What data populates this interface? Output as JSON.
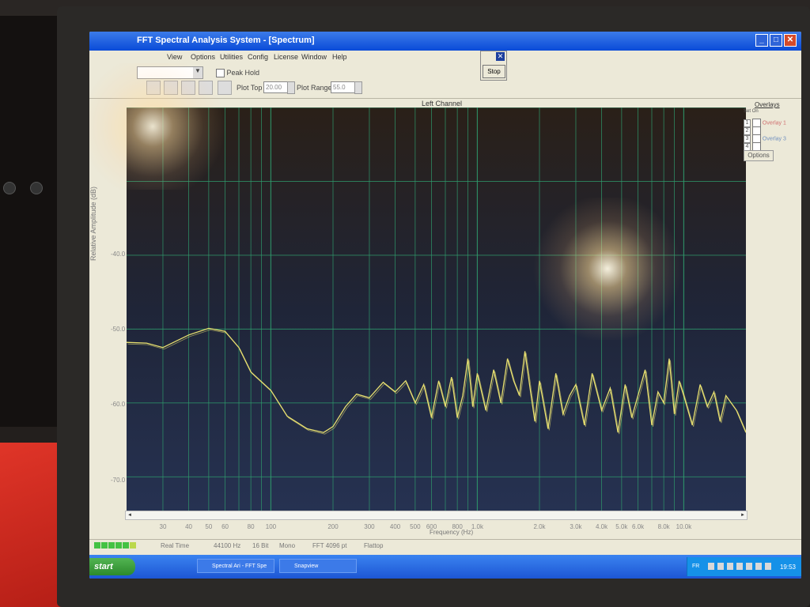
{
  "window": {
    "title": "FFT Spectral Analysis System - [Spectrum]",
    "icon": "app-icon"
  },
  "menu": [
    "View",
    "Options",
    "Utilities",
    "Config",
    "License",
    "Window",
    "Help"
  ],
  "toolbar": {
    "peak_hold_label": "Peak Hold",
    "plot_top_label": "Plot Top",
    "plot_top_value": "20.00",
    "plot_range_label": "Plot Range",
    "plot_range_value": "55.0"
  },
  "stop_dialog": {
    "button_label": "Stop",
    "close_glyph": "✕"
  },
  "channel_title": "Left Channel",
  "overlays": {
    "header": "Overlays",
    "set_label": "Set",
    "on_label": "On",
    "rows": [
      {
        "num": "1",
        "label": "Overlay 1",
        "color": "#d07070"
      },
      {
        "num": "2",
        "label": "",
        "color": "#d07070"
      },
      {
        "num": "3",
        "label": "Overlay 3",
        "color": "#7090c0"
      },
      {
        "num": "4",
        "label": "",
        "color": "#7090c0"
      }
    ],
    "options_label": "Options"
  },
  "chart_data": {
    "type": "line",
    "title": "Left Channel",
    "xlabel": "Frequency (Hz)",
    "ylabel": "Relative Amplitude (dB)",
    "x_scale": "log",
    "xlim": [
      20,
      20000
    ],
    "ylim": [
      -75,
      -20
    ],
    "y_ticks": [
      "-40.0",
      "-50.0",
      "-60.0",
      "-70.0"
    ],
    "x_ticks": [
      "30",
      "40",
      "50",
      "60",
      "80",
      "100",
      "200",
      "300",
      "400",
      "500",
      "600",
      "800",
      "1.0k",
      "2.0k",
      "3.0k",
      "4.0k",
      "5.0k",
      "6.0k",
      "8.0k",
      "10.0k"
    ],
    "grid": true,
    "series": [
      {
        "color": "#e8e070",
        "x": [
          20,
          25,
          30,
          40,
          50,
          60,
          70,
          80,
          100,
          120,
          150,
          180,
          200,
          230,
          260,
          300,
          350,
          400,
          450,
          500,
          550,
          600,
          650,
          700,
          750,
          800,
          850,
          900,
          950,
          1000,
          1100,
          1200,
          1300,
          1400,
          1500,
          1600,
          1700,
          1800,
          1900,
          2000,
          2200,
          2400,
          2600,
          2800,
          3000,
          3300,
          3600,
          4000,
          4400,
          4800,
          5200,
          5600,
          6000,
          6500,
          7000,
          7500,
          8000,
          8500,
          9000,
          9500,
          10000,
          11000,
          12000,
          13000,
          14000,
          15000,
          16000,
          18000,
          20000
        ],
        "y": [
          -51.8,
          -51.9,
          -52.5,
          -50.8,
          -49.9,
          -50.3,
          -52.5,
          -55.8,
          -58.3,
          -61.8,
          -63.5,
          -64.0,
          -63.2,
          -60.5,
          -58.8,
          -59.3,
          -57.2,
          -58.5,
          -57.0,
          -60.0,
          -57.5,
          -62.0,
          -57.0,
          -60.5,
          -56.5,
          -62.0,
          -59.0,
          -54.0,
          -60.5,
          -56.0,
          -61.0,
          -55.5,
          -60.0,
          -54.0,
          -57.0,
          -59.0,
          -53.0,
          -58.0,
          -62.5,
          -57.0,
          -63.5,
          -56.0,
          -61.5,
          -59.0,
          -57.5,
          -63.0,
          -56.0,
          -61.0,
          -58.0,
          -64.0,
          -57.5,
          -62.0,
          -59.0,
          -55.5,
          -63.0,
          -58.5,
          -60.0,
          -54.0,
          -61.5,
          -57.0,
          -59.0,
          -63.0,
          -57.5,
          -60.5,
          -58.5,
          -62.5,
          -59.0,
          -61.0,
          -64.0
        ]
      }
    ]
  },
  "status_bar": {
    "mode": "Real Time",
    "sample_rate": "44100 Hz",
    "bits": "16 Bit",
    "channels": "Mono",
    "fft": "FFT 4096 pt",
    "window_fn": "Flattop"
  },
  "taskbar": {
    "start_label": "start",
    "tasks": [
      "Spectral Ari - FFT Spe",
      "Snapview"
    ],
    "language": "FR",
    "clock": "19:53"
  }
}
